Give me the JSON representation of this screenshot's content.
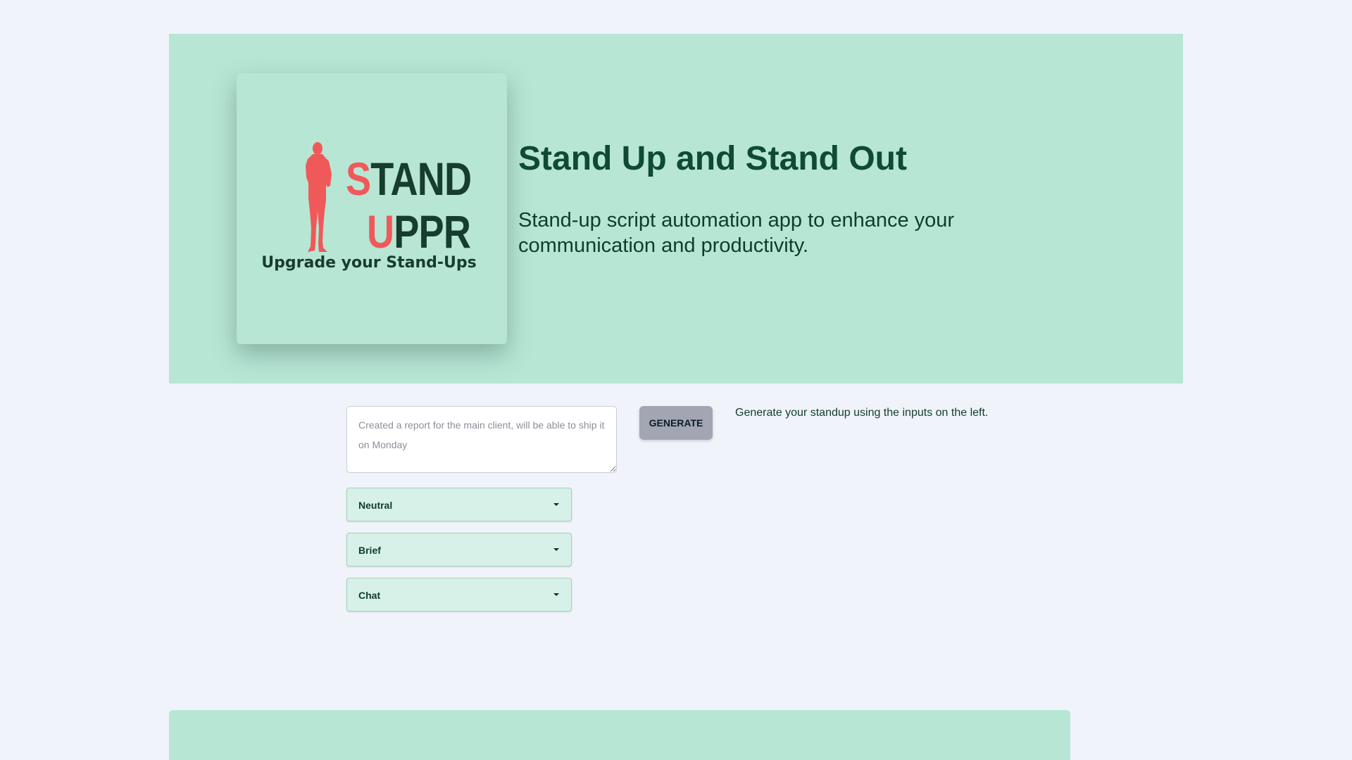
{
  "hero": {
    "logo": {
      "word1_accent": "S",
      "word1_rest": "TAND",
      "word2_accent": "U",
      "word2_rest": "PPR",
      "tagline": "Upgrade your Stand-Ups",
      "accent_color": "#f0595a",
      "text_color": "#173d2c",
      "figure_icon": "person-silhouette-icon"
    },
    "title": "Stand Up and Stand Out",
    "subtitle": "Stand-up script automation app to enhance your communication and productivity."
  },
  "form": {
    "report_placeholder": "Created a report for the main client, will be able to ship it on Monday",
    "report_value": "",
    "generate_label": "GENERATE",
    "selects": [
      {
        "value": "Neutral"
      },
      {
        "value": "Brief"
      },
      {
        "value": "Chat"
      }
    ]
  },
  "output": {
    "hint": "Generate your standup using the inputs on the left."
  },
  "colors": {
    "page_background": "#f0f3fa",
    "hero_background": "#b7e6d5",
    "select_background": "#d7f1e8",
    "button_background": "#a1a6b2",
    "heading_color": "#0f4a33"
  }
}
